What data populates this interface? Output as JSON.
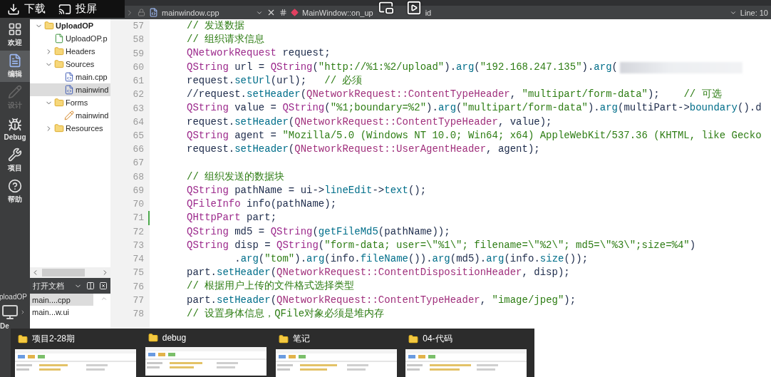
{
  "overlay_bar": {
    "items": [
      {
        "label": "下载",
        "kind": "download"
      },
      {
        "label": "投屏",
        "kind": "cast"
      }
    ]
  },
  "mode_bar": {
    "items": [
      {
        "label": "欢迎",
        "kind": "welcome",
        "selected": false,
        "disabled": false
      },
      {
        "label": "编辑",
        "kind": "edit",
        "selected": true,
        "disabled": false
      },
      {
        "label": "设计",
        "kind": "design",
        "selected": false,
        "disabled": true
      },
      {
        "label": "Debug",
        "kind": "debug",
        "selected": false,
        "disabled": false
      },
      {
        "label": "项目",
        "kind": "projects",
        "selected": false,
        "disabled": false
      },
      {
        "label": "帮助",
        "kind": "help",
        "selected": false,
        "disabled": false
      }
    ],
    "target": "ploadOP",
    "device": "De"
  },
  "project_tree": {
    "items": [
      {
        "label": "UploadOP",
        "kind": "project",
        "expanded": true,
        "selected": false,
        "children": [
          {
            "label": "UploadOP.p",
            "kind": "profile",
            "selected": false
          },
          {
            "label": "Headers",
            "kind": "headers",
            "expanded": false,
            "selected": false
          },
          {
            "label": "Sources",
            "kind": "sources",
            "expanded": true,
            "selected": false,
            "children": [
              {
                "label": "main.cpp",
                "kind": "cpp",
                "selected": false
              },
              {
                "label": "mainwind",
                "kind": "cpp",
                "selected": true
              }
            ]
          },
          {
            "label": "Forms",
            "kind": "forms",
            "expanded": true,
            "selected": false,
            "children": [
              {
                "label": "mainwind",
                "kind": "ui",
                "selected": false
              }
            ]
          },
          {
            "label": "Resources",
            "kind": "resources",
            "expanded": false,
            "selected": false
          }
        ]
      }
    ]
  },
  "open_documents": {
    "title": "打开文档",
    "items": [
      {
        "label": "main....cpp",
        "selected": true
      },
      {
        "label": "main...w.ui",
        "selected": false
      }
    ]
  },
  "editor_toolbar": {
    "file": "mainwindow.cpp",
    "symbol": "MainWindow::on_up",
    "symbol_tail": "id",
    "position": "Line: 10"
  },
  "editor": {
    "lines": [
      {
        "number": "57",
        "tokens": [
          {
            "text": "// 发送数据",
            "kind": "comment"
          }
        ]
      },
      {
        "number": "58",
        "tokens": [
          {
            "text": "// 组织请求信息",
            "kind": "comment"
          }
        ]
      },
      {
        "number": "59",
        "tokens": [
          {
            "text": "QNetworkRequest",
            "kind": "type"
          },
          {
            "text": " request;",
            "kind": "plain"
          }
        ]
      },
      {
        "number": "60",
        "redacted": true,
        "tokens": [
          {
            "text": "QString",
            "kind": "type"
          },
          {
            "text": " url = ",
            "kind": "plain"
          },
          {
            "text": "QString",
            "kind": "type"
          },
          {
            "text": "(",
            "kind": "plain"
          },
          {
            "text": "\"http://%1:%2/upload\"",
            "kind": "string"
          },
          {
            "text": ").",
            "kind": "plain"
          },
          {
            "text": "arg",
            "kind": "method"
          },
          {
            "text": "(",
            "kind": "plain"
          },
          {
            "text": "\"192.168.247.135\"",
            "kind": "string"
          },
          {
            "text": ").",
            "kind": "plain"
          },
          {
            "text": "arg",
            "kind": "method"
          },
          {
            "text": "(",
            "kind": "plain"
          }
        ]
      },
      {
        "number": "61",
        "tokens": [
          {
            "text": "request.",
            "kind": "plain"
          },
          {
            "text": "setUrl",
            "kind": "method"
          },
          {
            "text": "(url);   ",
            "kind": "plain"
          },
          {
            "text": "// 必须",
            "kind": "comment"
          }
        ]
      },
      {
        "number": "62",
        "tokens": [
          {
            "text": "//request.",
            "kind": "plain"
          },
          {
            "text": "setHeader",
            "kind": "method"
          },
          {
            "text": "(",
            "kind": "plain"
          },
          {
            "text": "QNetworkRequest::ContentTypeHeader",
            "kind": "enum"
          },
          {
            "text": ", ",
            "kind": "plain"
          },
          {
            "text": "\"multipart/form-data\"",
            "kind": "string"
          },
          {
            "text": ");    ",
            "kind": "plain"
          },
          {
            "text": "// 可选",
            "kind": "comment"
          }
        ]
      },
      {
        "number": "63",
        "tokens": [
          {
            "text": "QString",
            "kind": "type"
          },
          {
            "text": " value = ",
            "kind": "plain"
          },
          {
            "text": "QString",
            "kind": "type"
          },
          {
            "text": "(",
            "kind": "plain"
          },
          {
            "text": "\"%1;boundary=%2\"",
            "kind": "string"
          },
          {
            "text": ").",
            "kind": "plain"
          },
          {
            "text": "arg",
            "kind": "method"
          },
          {
            "text": "(",
            "kind": "plain"
          },
          {
            "text": "\"multipart/form-data\"",
            "kind": "string"
          },
          {
            "text": ").",
            "kind": "plain"
          },
          {
            "text": "arg",
            "kind": "method"
          },
          {
            "text": "(multiPart->",
            "kind": "plain"
          },
          {
            "text": "boundary",
            "kind": "method"
          },
          {
            "text": "().d",
            "kind": "plain"
          }
        ]
      },
      {
        "number": "64",
        "tokens": [
          {
            "text": "request.",
            "kind": "plain"
          },
          {
            "text": "setHeader",
            "kind": "method"
          },
          {
            "text": "(",
            "kind": "plain"
          },
          {
            "text": "QNetworkRequest::ContentTypeHeader",
            "kind": "enum"
          },
          {
            "text": ", value);",
            "kind": "plain"
          }
        ]
      },
      {
        "number": "65",
        "tokens": [
          {
            "text": "QString",
            "kind": "type"
          },
          {
            "text": " agent = ",
            "kind": "plain"
          },
          {
            "text": "\"Mozilla/5.0 (Windows NT 10.0; Win64; x64) AppleWebKit/537.36 (KHTML, like Gecko",
            "kind": "string"
          }
        ]
      },
      {
        "number": "66",
        "tokens": [
          {
            "text": "request.",
            "kind": "plain"
          },
          {
            "text": "setHeader",
            "kind": "method"
          },
          {
            "text": "(",
            "kind": "plain"
          },
          {
            "text": "QNetworkRequest::UserAgentHeader",
            "kind": "enum"
          },
          {
            "text": ", agent);",
            "kind": "plain"
          }
        ]
      },
      {
        "number": "67"
      },
      {
        "number": "68",
        "tokens": [
          {
            "text": "// 组织发送的数据块",
            "kind": "comment"
          }
        ]
      },
      {
        "number": "69",
        "tokens": [
          {
            "text": "QString",
            "kind": "type"
          },
          {
            "text": " pathName = ui->",
            "kind": "plain"
          },
          {
            "text": "lineEdit",
            "kind": "method"
          },
          {
            "text": "->",
            "kind": "plain"
          },
          {
            "text": "text",
            "kind": "method"
          },
          {
            "text": "();",
            "kind": "plain"
          }
        ]
      },
      {
        "number": "70",
        "tokens": [
          {
            "text": "QFileInfo",
            "kind": "type"
          },
          {
            "text": " info(pathName);",
            "kind": "plain"
          }
        ]
      },
      {
        "number": "71",
        "changed": true,
        "tokens": [
          {
            "text": "QHttpPart",
            "kind": "type"
          },
          {
            "text": " part;",
            "kind": "plain"
          }
        ]
      },
      {
        "number": "72",
        "tokens": [
          {
            "text": "QString",
            "kind": "type"
          },
          {
            "text": " md5 = ",
            "kind": "plain"
          },
          {
            "text": "QString",
            "kind": "type"
          },
          {
            "text": "(",
            "kind": "plain"
          },
          {
            "text": "getFileMd5",
            "kind": "method"
          },
          {
            "text": "(pathName));",
            "kind": "plain"
          }
        ]
      },
      {
        "number": "73",
        "tokens": [
          {
            "text": "QString",
            "kind": "type"
          },
          {
            "text": " disp = ",
            "kind": "plain"
          },
          {
            "text": "QString",
            "kind": "type"
          },
          {
            "text": "(",
            "kind": "plain"
          },
          {
            "text": "\"form-data; user=\\\"%1\\\"; filename=\\\"%2\\\"; md5=\\\"%3\\\";size=%4\"",
            "kind": "string"
          },
          {
            "text": ")",
            "kind": "plain"
          }
        ]
      },
      {
        "number": "74",
        "tokens": [
          {
            "text": "        .",
            "kind": "plain"
          },
          {
            "text": "arg",
            "kind": "method"
          },
          {
            "text": "(",
            "kind": "plain"
          },
          {
            "text": "\"tom\"",
            "kind": "string"
          },
          {
            "text": ").",
            "kind": "plain"
          },
          {
            "text": "arg",
            "kind": "method"
          },
          {
            "text": "(info.",
            "kind": "plain"
          },
          {
            "text": "fileName",
            "kind": "method"
          },
          {
            "text": "()).",
            "kind": "plain"
          },
          {
            "text": "arg",
            "kind": "method"
          },
          {
            "text": "(md5).",
            "kind": "plain"
          },
          {
            "text": "arg",
            "kind": "method"
          },
          {
            "text": "(info.",
            "kind": "plain"
          },
          {
            "text": "size",
            "kind": "method"
          },
          {
            "text": "());",
            "kind": "plain"
          }
        ]
      },
      {
        "number": "75",
        "tokens": [
          {
            "text": "part.",
            "kind": "plain"
          },
          {
            "text": "setHeader",
            "kind": "method"
          },
          {
            "text": "(",
            "kind": "plain"
          },
          {
            "text": "QNetworkRequest::ContentDispositionHeader",
            "kind": "enum"
          },
          {
            "text": ", disp);",
            "kind": "plain"
          }
        ]
      },
      {
        "number": "76",
        "tokens": [
          {
            "text": "// 根据用户上传的文件格式选择类型",
            "kind": "comment"
          }
        ]
      },
      {
        "number": "77",
        "tokens": [
          {
            "text": "part.",
            "kind": "plain"
          },
          {
            "text": "setHeader",
            "kind": "method"
          },
          {
            "text": "(",
            "kind": "plain"
          },
          {
            "text": "QNetworkRequest::ContentTypeHeader",
            "kind": "enum"
          },
          {
            "text": ", ",
            "kind": "plain"
          },
          {
            "text": "\"image/jpeg\"",
            "kind": "string"
          },
          {
            "text": ");",
            "kind": "plain"
          }
        ]
      },
      {
        "number": "78",
        "tokens": [
          {
            "text": "// 设置身体信息，QFile对象必须是堆内存",
            "kind": "comment"
          }
        ]
      }
    ]
  },
  "taskbar_previews": [
    {
      "title": "项目2-28期",
      "kind": "picture"
    },
    {
      "title": "debug",
      "kind": "picture"
    },
    {
      "title": "笔记",
      "kind": "picture"
    },
    {
      "title": "04-代码",
      "kind": "picture"
    }
  ]
}
